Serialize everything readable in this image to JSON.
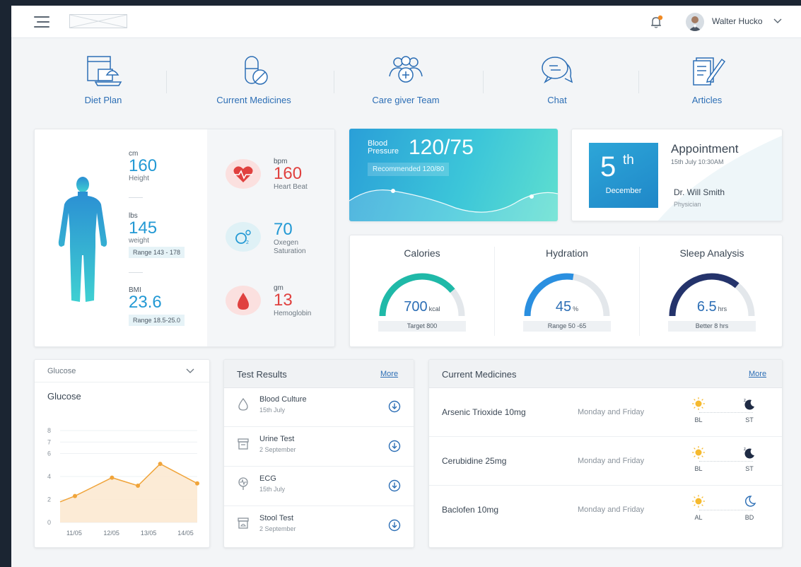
{
  "header": {
    "username": "Walter Hucko"
  },
  "nav": [
    {
      "label": "Diet Plan",
      "icon": "diet-plan-icon"
    },
    {
      "label": "Current Medicines",
      "icon": "medicines-icon"
    },
    {
      "label": "Care giver Team",
      "icon": "care-team-icon"
    },
    {
      "label": "Chat",
      "icon": "chat-icon"
    },
    {
      "label": "Articles",
      "icon": "articles-icon"
    }
  ],
  "vitals": {
    "height": {
      "unit": "cm",
      "value": "160",
      "label": "Height"
    },
    "weight": {
      "unit": "lbs",
      "value": "145",
      "label": "weight",
      "range": "Range 143 - 178"
    },
    "bmi": {
      "unit": "BMI",
      "value": "23.6",
      "range": "Range 18.5-25.0"
    },
    "heart": {
      "unit": "bpm",
      "value": "160",
      "label": "Heart Beat"
    },
    "oxygen": {
      "value": "70",
      "label_line1": "Oxegen",
      "label_line2": "Saturation"
    },
    "hemoglobin": {
      "unit": "gm",
      "value": "13",
      "label": "Hemoglobin"
    }
  },
  "blood_pressure": {
    "title_line1": "Blood",
    "title_line2": "Pressure",
    "value": "120/75",
    "recommended": "Recommended 120/80"
  },
  "appointment": {
    "day": "5",
    "day_suffix": "th",
    "month": "December",
    "title": "Appointment",
    "time": "15th July 10:30AM",
    "doctor": "Dr. Will Smith",
    "role": "Physician"
  },
  "stats": [
    {
      "title": "Calories",
      "value": "700",
      "unit": "kcal",
      "chip": "Target 800",
      "fraction": 0.78,
      "color": "#1fb9a8"
    },
    {
      "title": "Hydration",
      "value": "45",
      "unit": "%",
      "chip": "Range 50 -65",
      "fraction": 0.55,
      "color": "#2a8fe0"
    },
    {
      "title": "Sleep Analysis",
      "value": "6.5",
      "unit": "hrs",
      "chip": "Better 8 hrs",
      "fraction": 0.72,
      "color": "#24336b"
    }
  ],
  "glucose": {
    "dropdown_label": "Glucose",
    "title": "Glucose"
  },
  "chart_data": {
    "type": "area",
    "title": "Glucose",
    "x_ticks": [
      "11/05",
      "12/05",
      "13/05",
      "14/05"
    ],
    "y_ticks": [
      "0",
      "2",
      "4",
      "6",
      "7",
      "8"
    ],
    "points": [
      {
        "x": 10.6,
        "y": 1.8
      },
      {
        "x": 11.0,
        "y": 2.3
      },
      {
        "x": 12.0,
        "y": 3.9
      },
      {
        "x": 12.7,
        "y": 3.2
      },
      {
        "x": 13.3,
        "y": 5.1
      },
      {
        "x": 14.3,
        "y": 3.4
      }
    ],
    "ylim": [
      0,
      8
    ],
    "color": "#f0a43a"
  },
  "tests": {
    "title": "Test Results",
    "more": "More",
    "items": [
      {
        "name": "Blood Culture",
        "date": "15th July",
        "icon": "blood-drop-icon"
      },
      {
        "name": "Urine Test",
        "date": "2 September",
        "icon": "urine-container-icon"
      },
      {
        "name": "ECG",
        "date": "15th July",
        "icon": "ecg-icon"
      },
      {
        "name": "Stool Test",
        "date": "2 September",
        "icon": "stool-container-icon"
      }
    ]
  },
  "medicines": {
    "title": "Current Medicines",
    "more": "More",
    "items": [
      {
        "name": "Arsenic Trioxide 10mg",
        "days": "Monday and Friday",
        "slot1": "BL",
        "slot2": "ST",
        "icon2": "moon-sleep-icon"
      },
      {
        "name": "Cerubidine 25mg",
        "days": "Monday and Friday",
        "slot1": "BL",
        "slot2": "ST",
        "icon2": "moon-sleep-icon"
      },
      {
        "name": "Baclofen 10mg",
        "days": "Monday and Friday",
        "slot1": "AL",
        "slot2": "BD",
        "icon2": "moon-icon"
      }
    ]
  }
}
